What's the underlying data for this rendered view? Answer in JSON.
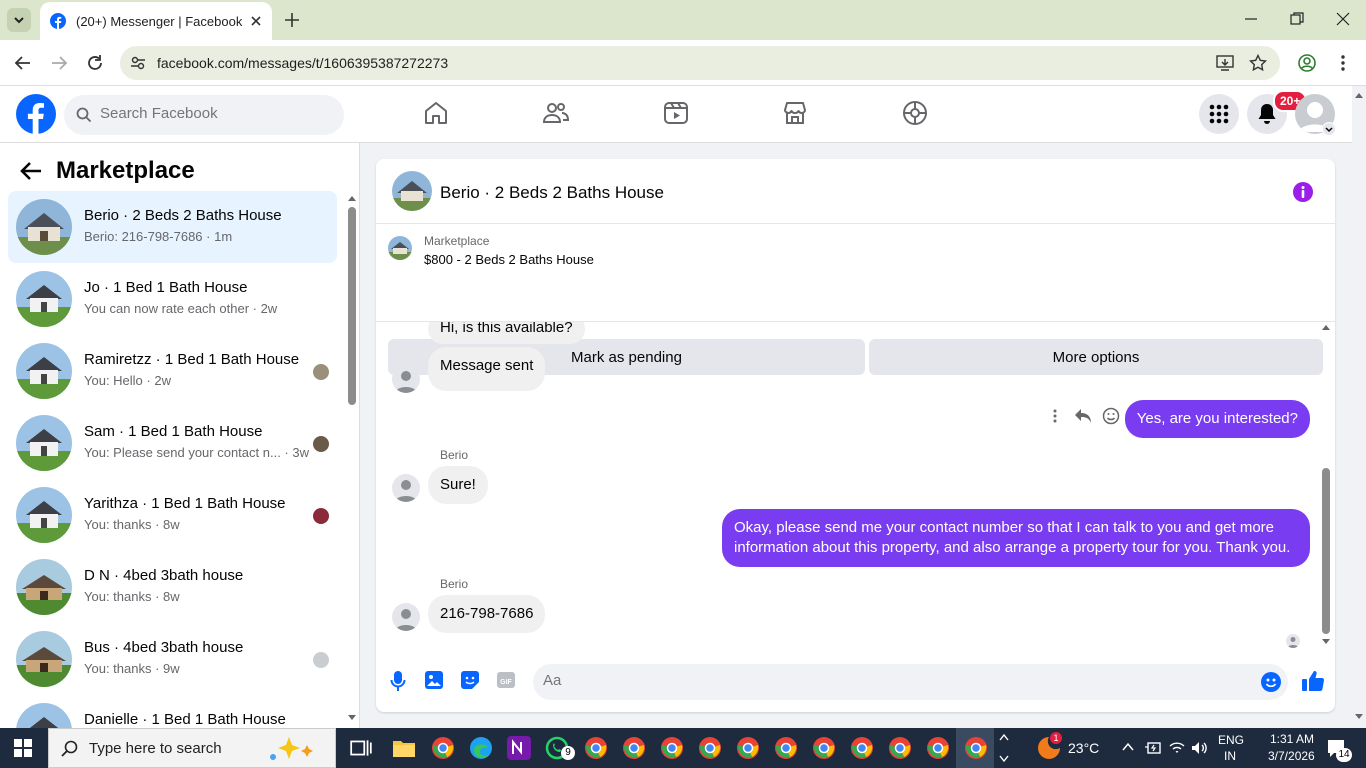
{
  "browser": {
    "tab_title": "(20+) Messenger | Facebook",
    "url": "facebook.com/messages/t/1606395387272273"
  },
  "header": {
    "search_placeholder": "Search Facebook",
    "notification_badge": "20+"
  },
  "sidebar": {
    "title": "Marketplace",
    "conversations": [
      {
        "name": "Berio · 2 Beds 2 Baths House",
        "preview": "Berio: 216-798-7686 · 1m"
      },
      {
        "name": "Jo · 1 Bed 1 Bath House",
        "preview": "You can now rate each other · 2w"
      },
      {
        "name": "Ramiretzz · 1 Bed 1 Bath House",
        "preview": "You: Hello · 2w"
      },
      {
        "name": "Sam · 1 Bed 1 Bath House",
        "preview": "You: Please send your contact n... · 3w"
      },
      {
        "name": "Yarithza · 1 Bed 1 Bath House",
        "preview": "You: thanks · 8w"
      },
      {
        "name": "D N · 4bed 3bath house",
        "preview": "You: thanks · 8w"
      },
      {
        "name": "Bus · 4bed 3bath house",
        "preview": "You: thanks · 9w"
      },
      {
        "name": "Danielle · 1 Bed 1 Bath House",
        "preview": ""
      }
    ]
  },
  "chat": {
    "title": "Berio · 2 Beds 2 Baths House",
    "marketplace_label": "Marketplace",
    "listing": "$800 - 2 Beds 2 Baths House",
    "mark_pending": "Mark as pending",
    "more_options": "More options",
    "messages": {
      "m1": "Hi, is this available?",
      "m2": "Message sent",
      "m3": "Yes, are you interested?",
      "sender1": "Berio",
      "m4": "Sure!",
      "m5": "Okay, please send me your contact number so that I can talk to you and get more information about this property, and also arrange a property tour for you. Thank you.",
      "sender2": "Berio",
      "m6": "216-798-7686"
    },
    "composer_placeholder": "Aa",
    "accent": "#7a3cf0"
  },
  "taskbar": {
    "search_placeholder": "Type here to search",
    "weather": "23°C",
    "lang": "ENG",
    "region": "IN",
    "time": "1:31 AM",
    "date": "3/7/2026",
    "notification_count": "14",
    "whatsapp_count": "9",
    "weather_alert": "1"
  }
}
